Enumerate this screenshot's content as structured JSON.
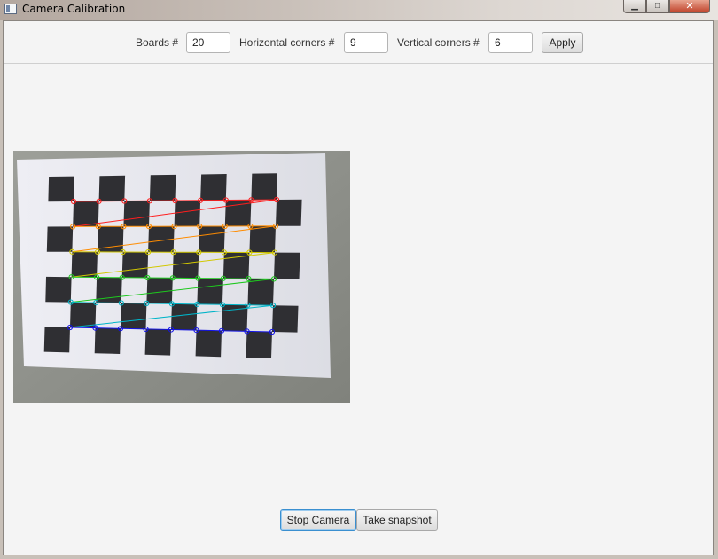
{
  "window": {
    "title": "Camera Calibration",
    "controls": {
      "minimize": "▁",
      "maximize": "□",
      "close": "✕"
    }
  },
  "settings": {
    "boards_label": "Boards #",
    "boards_value": "20",
    "horizontal_label": "Horizontal corners #",
    "horizontal_value": "9",
    "vertical_label": "Vertical corners #",
    "vertical_value": "6",
    "apply_label": "Apply"
  },
  "camera_view": {
    "icon": "camera-frame",
    "corner_row_colors": [
      "#ff1e1e",
      "#ff8c00",
      "#d2c800",
      "#1ec81e",
      "#00b4c8",
      "#1414e6"
    ]
  },
  "actions": {
    "stop_camera_label": "Stop Camera",
    "take_snapshot_label": "Take snapshot"
  }
}
